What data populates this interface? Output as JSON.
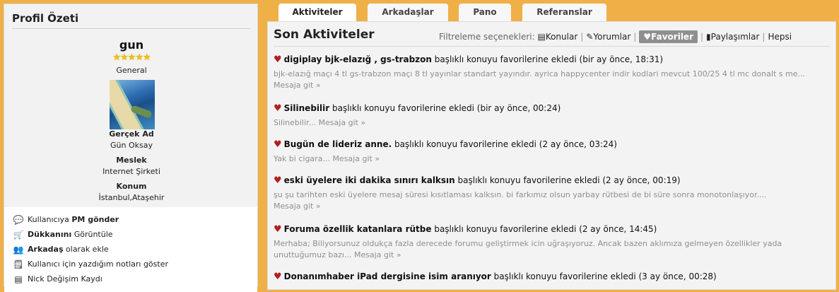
{
  "tabs": [
    "Aktiviteler",
    "Arkadaşlar",
    "Pano",
    "Referanslar"
  ],
  "profile": {
    "title": "Profil Özeti",
    "username": "gun",
    "stars": "★★★★★",
    "rank": "General",
    "real_name_label": "Gerçek Ad",
    "real_name": "Gün Oksay",
    "job_label": "Meslek",
    "job": "Internet Şirketi",
    "location_label": "Konum",
    "location": "İstanbul,Ataşehir"
  },
  "actions": [
    {
      "pre": "Kullanıcıya ",
      "bold": "PM gönder",
      "post": "",
      "icon": "💬",
      "icon_name": "speech-bubble-icon"
    },
    {
      "pre": "",
      "bold": "Dükkanını",
      "post": " Görüntüle",
      "icon": "🛒",
      "icon_name": "cart-icon"
    },
    {
      "pre": "",
      "bold": "Arkadaş",
      "post": " olarak ekle",
      "icon": "👥",
      "icon_name": "add-friend-icon"
    },
    {
      "pre": "Kullanıcı için yazdığım notları göster",
      "bold": "",
      "post": "",
      "icon": "🗒",
      "icon_name": "note-icon"
    },
    {
      "pre": "Nick Değişim Kaydı",
      "bold": "",
      "post": "",
      "icon": "▤",
      "icon_name": "history-icon"
    }
  ],
  "main": {
    "title": "Son Aktiviteler",
    "filter_label": "Filtreleme seçenekleri:",
    "filters": [
      {
        "label": "Konular",
        "icon": "▤"
      },
      {
        "label": "Yorumlar",
        "icon": "✎"
      },
      {
        "label": "Favoriler",
        "icon": "♥",
        "active": true
      },
      {
        "label": "Paylaşımlar",
        "icon": "▮"
      },
      {
        "label": "Hepsi",
        "icon": ""
      }
    ]
  },
  "items": [
    {
      "title": "digiplay bjk-elazığ , gs-trabzon",
      "action": " başlıklı konuyu favorilerine ekledi (bir ay önce, 18:31)",
      "excerpt": "bjk-elazığ maçı 4 tl gs-trabzon maçı 8 tl yayınlar standart yayındır. ayrica happycenter indir kodlari mevcut 100/25 4 tl mc donalt s me...",
      "excerpt2": "",
      "link": "Mesaja git »"
    },
    {
      "title": "Silinebilir",
      "action": " başlıklı konuyu favorilerine ekledi (bir ay önce, 00:24)",
      "excerpt": "Silinebilir...",
      "excerpt2": "",
      "link": "Mesaja git »"
    },
    {
      "title": "Bugün de lideriz anne.",
      "action": " başlıklı konuyu favorilerine ekledi (2 ay önce, 03:24)",
      "excerpt": "Yak bi cigara...",
      "excerpt2": "",
      "link": "Mesaja git »"
    },
    {
      "title": "eski üyelere iki dakika sınırı kalksın",
      "action": " başlıklı konuyu favorilerine ekledi (2 ay önce, 00:19)",
      "excerpt": "şu şu tarihten eski üyelere mesaj süresi kısıtlaması kalksın. bi farkımız olsun yarbay rütbesi de bi süre sonra monotonlaşıyor....",
      "excerpt2": "",
      "link": "Mesaja git »"
    },
    {
      "title": "Foruma özellik katanlara rütbe",
      "action": " başlıklı konuyu favorilerine ekledi (2 ay önce, 14:45)",
      "excerpt": "Merhaba; Biliyorsunuz oldukça fazla derecede forumu geliştirmek icin uğraşıyoruz. Ancak bazen aklımıza gelmeyen özellikler yada",
      "excerpt2": "unuttuğumuz bazı...",
      "link": "Mesaja git »"
    },
    {
      "title": "Donanımhaber iPad dergisine isim aranıyor",
      "action": " başlıklı konuyu favorilerine ekledi (3 ay önce, 00:28)",
      "excerpt": "",
      "excerpt2": "",
      "link": ""
    }
  ]
}
